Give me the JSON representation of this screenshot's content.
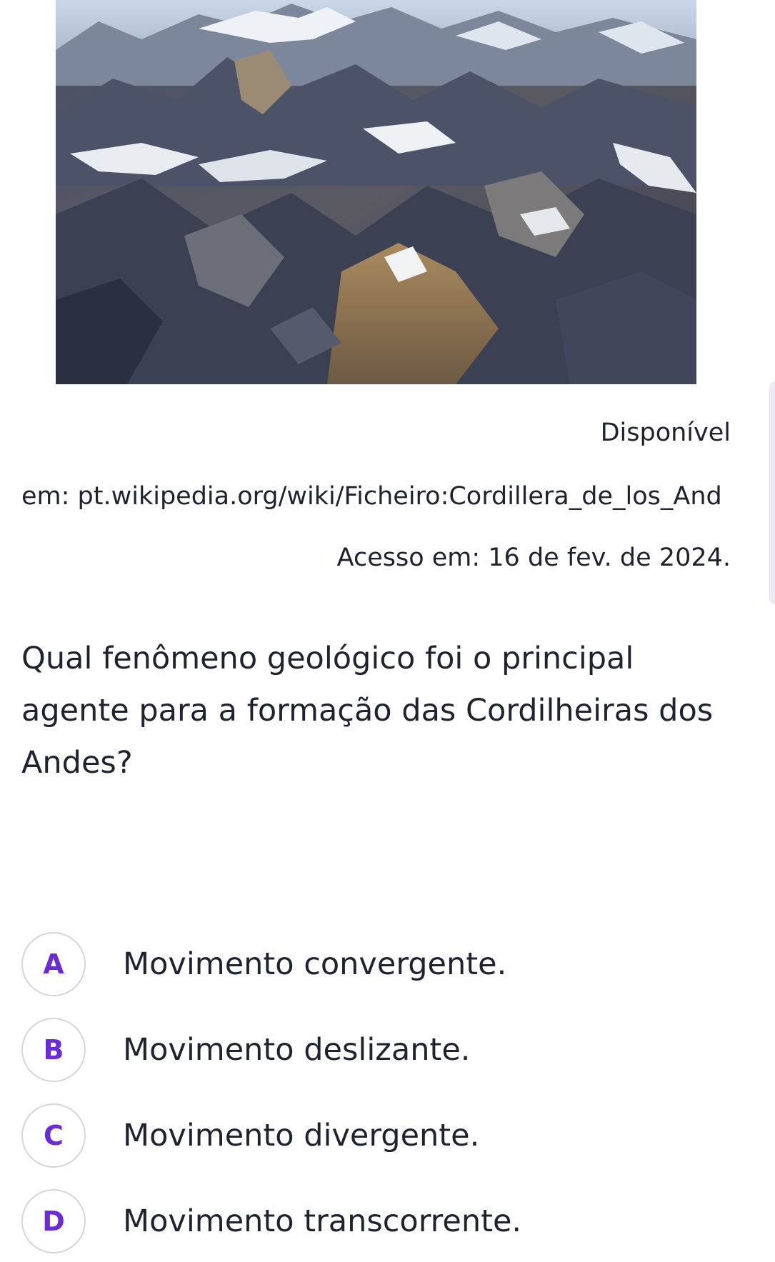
{
  "image": {
    "icon": "mountain-landscape-photo",
    "colors": {
      "sky": "#d6e0ec",
      "snow": "#f2f4f6",
      "rock_dark": "#3e4353",
      "rock_brown": "#8a6f4e",
      "shadow": "#262b3a"
    }
  },
  "caption": {
    "line1": "Disponível",
    "line2": "em: pt.wikipedia.org/wiki/Ficheiro:Cordillera_de_los_And",
    "line3": "Acesso em: 16 de fev. de 2024."
  },
  "question": {
    "text": "Qual fenômeno geológico foi o principal agente para a formação das Cordilheiras dos Andes?"
  },
  "options": [
    {
      "letter": "A",
      "text": "Movimento convergente."
    },
    {
      "letter": "B",
      "text": "Movimento deslizante."
    },
    {
      "letter": "C",
      "text": "Movimento divergente."
    },
    {
      "letter": "D",
      "text": "Movimento transcorrente."
    }
  ],
  "theme": {
    "accent": "#6b2bd9",
    "text": "#1f2330",
    "border": "#d5d6dc"
  }
}
